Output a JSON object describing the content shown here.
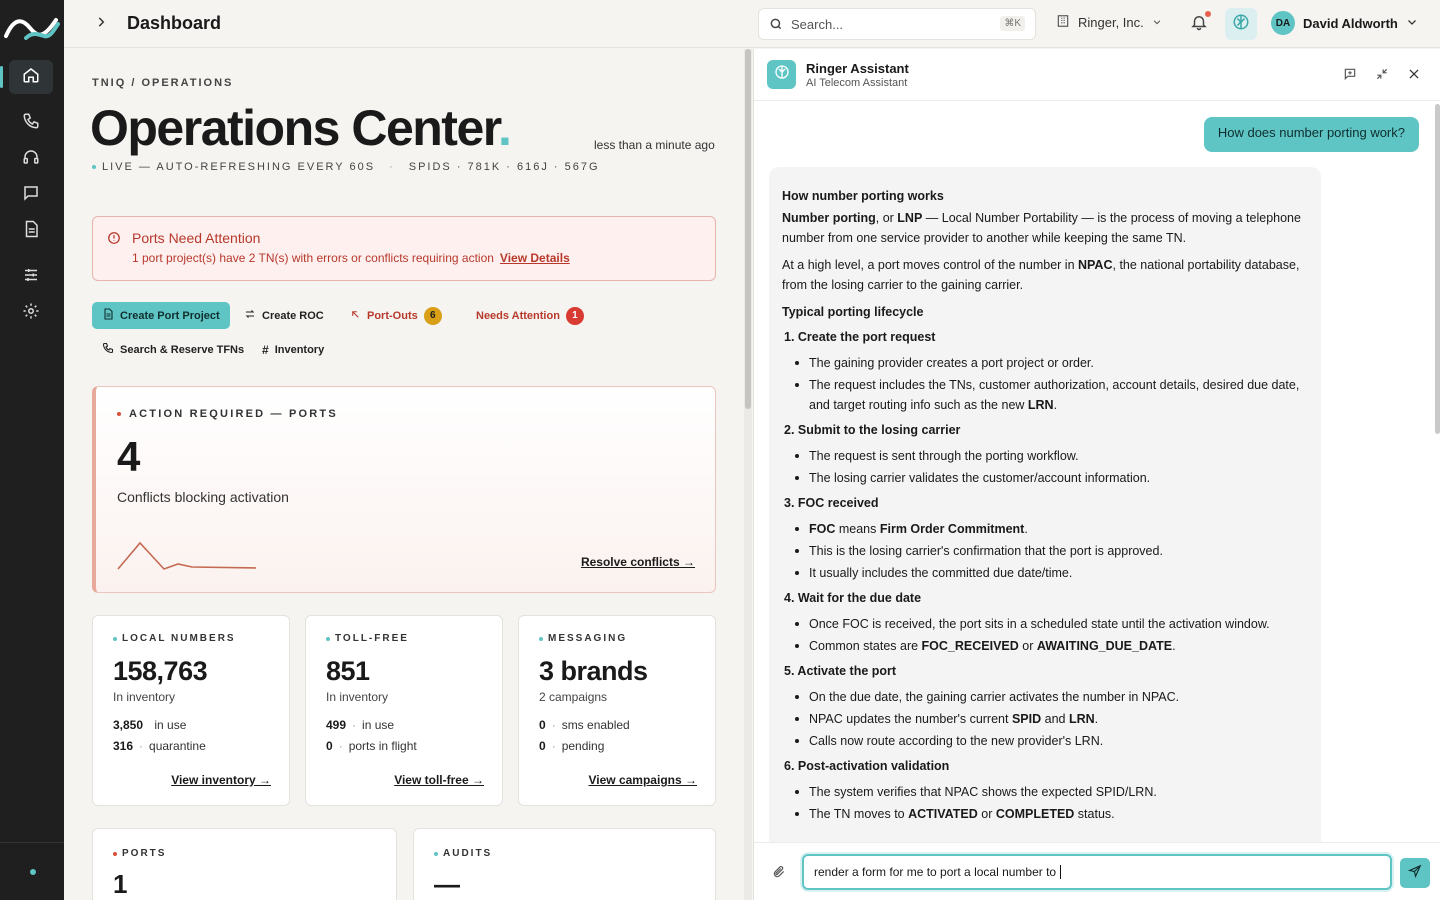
{
  "header": {
    "title": "Dashboard",
    "search_placeholder": "Search...",
    "search_shortcut": "⌘K",
    "org_name": "Ringer, Inc.",
    "user_initials": "DA",
    "user_name": "David Aldworth"
  },
  "sidebar": {
    "items": [
      {
        "name": "home"
      },
      {
        "name": "phone"
      },
      {
        "name": "headset"
      },
      {
        "name": "chat"
      },
      {
        "name": "document"
      },
      {
        "name": "sliders"
      },
      {
        "name": "settings"
      }
    ]
  },
  "page": {
    "breadcrumb": "TNIQ  /  OPERATIONS",
    "title": "Operations Center",
    "title_period": ".",
    "updated": "less than a minute ago",
    "live_text": "LIVE — AUTO-REFRESHING EVERY 60S",
    "spids_text": "SPIDS · 781K · 616J · 567G"
  },
  "alert": {
    "title": "Ports Need Attention",
    "desc": "1 port project(s) have 2 TN(s) with errors or conflicts requiring action",
    "link": "View Details"
  },
  "actions": {
    "create_port": "Create Port Project",
    "create_roc": "Create ROC",
    "port_outs": "Port-Outs",
    "port_outs_count": "6",
    "needs_attention": "Needs Attention",
    "needs_attention_count": "1",
    "search_tfns": "Search & Reserve TFNs",
    "inventory": "Inventory"
  },
  "hero": {
    "label": "ACTION REQUIRED — PORTS",
    "value": "4",
    "sub": "Conflicts blocking activation",
    "link": "Resolve conflicts →"
  },
  "cards": {
    "local": {
      "label": "LOCAL NUMBERS",
      "value": "158,763",
      "sub": "In inventory",
      "r1_n": "3,850",
      "r1_t": "in use",
      "r2_n": "316",
      "r2_t": "quarantine",
      "link": "View inventory →"
    },
    "tollfree": {
      "label": "TOLL-FREE",
      "value": "851",
      "sub": "In inventory",
      "r1_n": "499",
      "r1_t": "in use",
      "r2_n": "0",
      "r2_t": "ports in flight",
      "link": "View toll-free →"
    },
    "messaging": {
      "label": "MESSAGING",
      "value": "3 brands",
      "sub": "2 campaigns",
      "r1_n": "0",
      "r1_t": "sms enabled",
      "r2_n": "0",
      "r2_t": "pending",
      "link": "View campaigns →"
    },
    "ports": {
      "label": "PORTS",
      "value": "1"
    },
    "audits": {
      "label": "AUDITS",
      "value": "—"
    }
  },
  "colors": {
    "accent": "#5fc4c4",
    "alert": "#b8392c",
    "amber": "#d9a017",
    "sidebar": "#1f1f1f"
  },
  "assistant": {
    "name": "Ringer Assistant",
    "subtitle": "AI Telecom Assistant",
    "user_message": "How does number porting work?",
    "response": {
      "heading": "How number porting works",
      "p1_b1": "Number porting",
      "p1_m1": ", or ",
      "p1_b2": "LNP",
      "p1_rest": " — Local Number Portability — is the process of moving a telephone number from one service provider to another while keeping the same TN.",
      "p2_a": "At a high level, a port moves control of the number in ",
      "p2_b": "NPAC",
      "p2_c": ", the national portability database, from the losing carrier to the gaining carrier.",
      "lifecycle": "Typical porting lifecycle",
      "s1": "1. Create the port request",
      "s1_i1": "The gaining provider creates a port project or order.",
      "s1_i2a": "The request includes the TNs, customer authorization, account details, desired due date, and target routing info such as the new ",
      "s1_i2b": "LRN",
      "s1_i2c": ".",
      "s2": "2. Submit to the losing carrier",
      "s2_i1": "The request is sent through the porting workflow.",
      "s2_i2": "The losing carrier validates the customer/account information.",
      "s3": "3. FOC received",
      "s3_i1a": "FOC",
      "s3_i1b": " means ",
      "s3_i1c": "Firm Order Commitment",
      "s3_i1d": ".",
      "s3_i2": "This is the losing carrier's confirmation that the port is approved.",
      "s3_i3": "It usually includes the committed due date/time.",
      "s4": "4. Wait for the due date",
      "s4_i1": "Once FOC is received, the port sits in a scheduled state until the activation window.",
      "s4_i2a": "Common states are ",
      "s4_i2b": "FOC_RECEIVED",
      "s4_i2c": " or ",
      "s4_i2d": "AWAITING_DUE_DATE",
      "s4_i2e": ".",
      "s5": "5. Activate the port",
      "s5_i1": "On the due date, the gaining carrier activates the number in NPAC.",
      "s5_i2a": "NPAC updates the number's current ",
      "s5_i2b": "SPID",
      "s5_i2c": " and ",
      "s5_i2d": "LRN",
      "s5_i2e": ".",
      "s5_i3": "Calls now route according to the new provider's LRN.",
      "s6": "6. Post-activation validation",
      "s6_i1": "The system verifies that NPAC shows the expected SPID/LRN.",
      "s6_i2a": "The TN moves to ",
      "s6_i2b": "ACTIVATED",
      "s6_i2c": " or ",
      "s6_i2d": "COMPLETED",
      "s6_i2e": " status."
    },
    "input_value": "render a form for me to port a local number to "
  }
}
